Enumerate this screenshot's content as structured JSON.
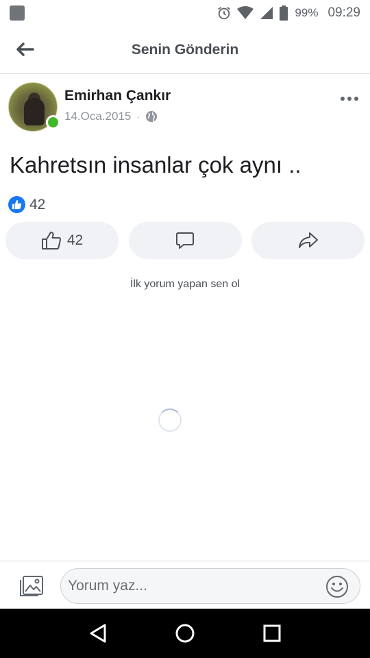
{
  "status_bar": {
    "battery": "99%",
    "time": "09:29",
    "icons": [
      "alarm-icon",
      "wifi-icon",
      "signal-icon",
      "battery-icon"
    ]
  },
  "header": {
    "title": "Senin Gönderin",
    "back_icon": "arrow-left-icon"
  },
  "post": {
    "author": "Emirhan Çankır",
    "date": "14.Oca.2015",
    "separator": "·",
    "privacy_icon": "globe-icon",
    "online": true,
    "text": "Kahretsın insanlar çok aynı ..",
    "reaction_count": "42",
    "actions": {
      "like_count": "42",
      "like_icon": "thumbs-up-icon",
      "comment_icon": "comment-icon",
      "share_icon": "share-icon"
    }
  },
  "comments": {
    "empty_text": "İlk yorum yapan sen ol"
  },
  "comment_bar": {
    "placeholder": "Yorum yaz...",
    "photo_icon": "photo-icon",
    "emoji_icon": "emoji-icon"
  },
  "colors": {
    "accent": "#1877f2",
    "online": "#42b72a",
    "button_bg": "#f0f2f5",
    "text_secondary": "#90949c"
  }
}
